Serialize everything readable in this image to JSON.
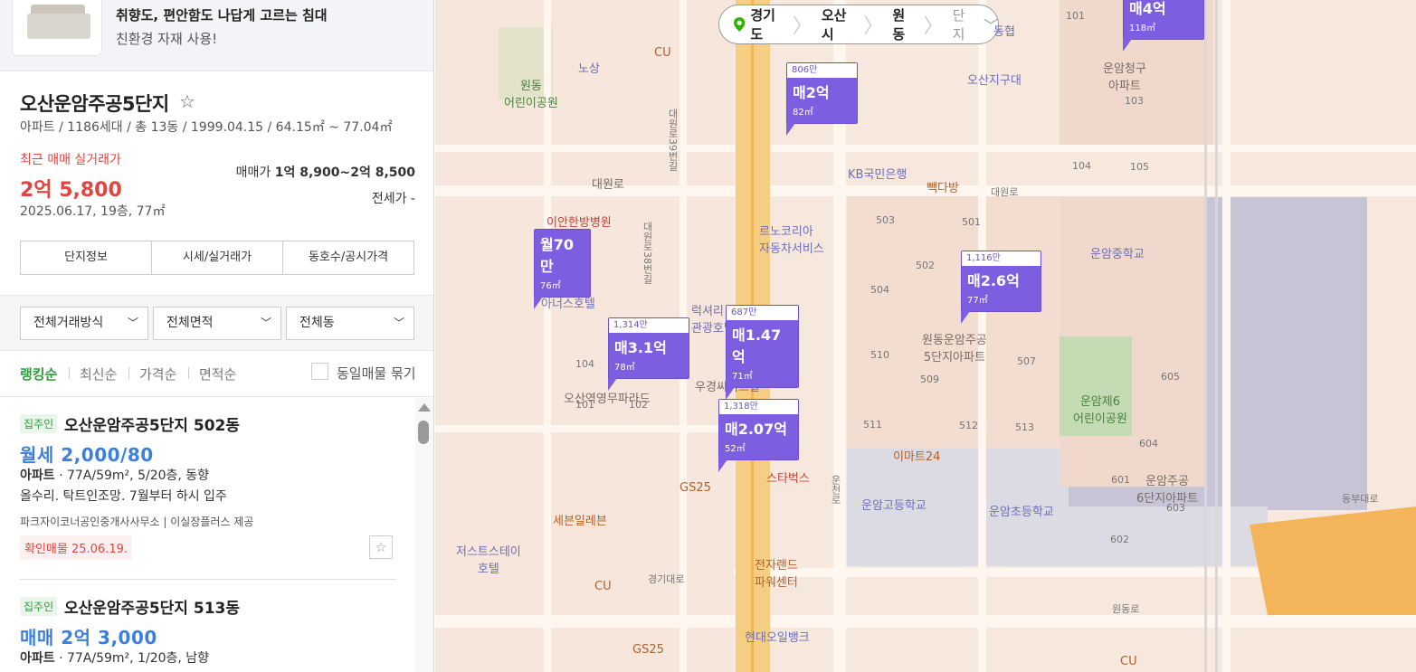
{
  "ad": {
    "title": "취향도, 편안함도 나답게 고르는 침대",
    "subtitle": "친환경 자재 사용!"
  },
  "complex": {
    "name": "오산운암주공5단지",
    "favorite_icon": "star-outline-icon",
    "meta": "아파트 / 1186세대 / 총 13동 / 1999.04.15 / 64.15㎡ ~ 77.04㎡",
    "recent_label": "최근 매매 실거래가",
    "recent_price": "2억 5,800",
    "recent_date": "2025.06.17, 19층, 77㎡",
    "sale_label": "매매가",
    "sale_range": "1억 8,900~2억 8,500",
    "jeonse": "전세가 -",
    "tabs": [
      "단지정보",
      "시세/실거래가",
      "동호수/공시가격"
    ]
  },
  "filters": {
    "deal_type": "전체거래방식",
    "area": "전체면적",
    "building": "전체동"
  },
  "sort": {
    "options": [
      "랭킹순",
      "최신순",
      "가격순",
      "면적순"
    ],
    "group_label": "동일매물 묶기"
  },
  "listings": [
    {
      "badge": "집주인",
      "title": "오산운암주공5단지 502동",
      "price": "월세 2,000/80",
      "type": "아파트",
      "spec": " · 77A/59m², 5/20층, 동향",
      "desc": "올수리. 탁트인조망. 7월부터 하시 입주",
      "agent": "파크자이코너공인중개사사무소 | 이실장플러스 제공",
      "confirm": "확인매물 25.06.19."
    },
    {
      "badge": "집주인",
      "title": "오산운암주공5단지 513동",
      "price": "매매 2억 3,000",
      "type": "아파트",
      "spec": " · 77A/59m², 1/20층, 남향"
    }
  ],
  "breadcrumb": {
    "items": [
      "경기도",
      "오산시",
      "원동"
    ],
    "last": "단지",
    "pin_color": "#2db400"
  },
  "map_markers": [
    {
      "unit": "806만",
      "price": "매2억",
      "area": "82㎡"
    },
    {
      "unit": "",
      "price": "월70만",
      "area": "76㎡"
    },
    {
      "unit": "1,314만",
      "price": "매3.1억",
      "area": "78㎡"
    },
    {
      "unit": "687만",
      "price": "매1.47억",
      "area": "71㎡"
    },
    {
      "unit": "1,318만",
      "price": "매2.07억",
      "area": "52㎡"
    },
    {
      "unit": "1,116만",
      "price": "매2.6억",
      "area": "77㎡"
    },
    {
      "unit": "",
      "price": "매4억",
      "area": "118㎡"
    }
  ],
  "map_labels": {
    "cu1": "CU",
    "nosang": "노상",
    "wondong_park": "원동\n어린이공원",
    "daewonro": "대원로",
    "ian": "이안한방병원",
    "anus": "아너스호텔",
    "luxury": "럭셔리\n관광호텔",
    "renault": "르노코리아\n자동차서비스",
    "kb": "KB국민은행",
    "ppang": "빽다방",
    "osan_gu": "오산지구대",
    "dong_hyup": "동협",
    "unam_cheong": "운암청구\n아파트",
    "osan_parade": "오산역영무파라드",
    "woogyeong": "우경씨이트빌",
    "wondong5": "원동운암주공\n5단지아파트",
    "unam_mid": "운암중학교",
    "unam6park": "운암제6\n어린이공원",
    "emart24": "이마트24",
    "starbucks": "스타벅스",
    "gs25_1": "GS25",
    "seven": "세븐일레븐",
    "jeostress": "저스트스테이\n호텔",
    "cu2": "CU",
    "gyeonggidaero": "경기대로",
    "etland": "전자랜드\n파워센터",
    "hyundai": "현대오일뱅크",
    "gs25_2": "GS25",
    "unam_high": "운암고등학교",
    "unam_elem": "운암초등학교",
    "unam6apt": "운암주공\n6단지아파트",
    "wondongro": "원동로",
    "dongbu": "동부대로",
    "cu3": "CU",
    "daewonro2": "대원로",
    "b101": "101",
    "b103": "103",
    "b104": "104",
    "b105": "105",
    "b503": "503",
    "b501": "501",
    "b502": "502",
    "b504": "504",
    "b510": "510",
    "b509": "509",
    "b507": "507",
    "b511": "511",
    "b512": "512",
    "b513": "513",
    "b605": "605",
    "b604": "604",
    "b601": "601",
    "b603": "603",
    "b602": "602",
    "bl104": "104",
    "bl101": "101",
    "bl102": "102",
    "r39": "대원로39번길",
    "r38": "대원로38번길",
    "unamro": "운천로",
    "osansi": "오산시"
  }
}
